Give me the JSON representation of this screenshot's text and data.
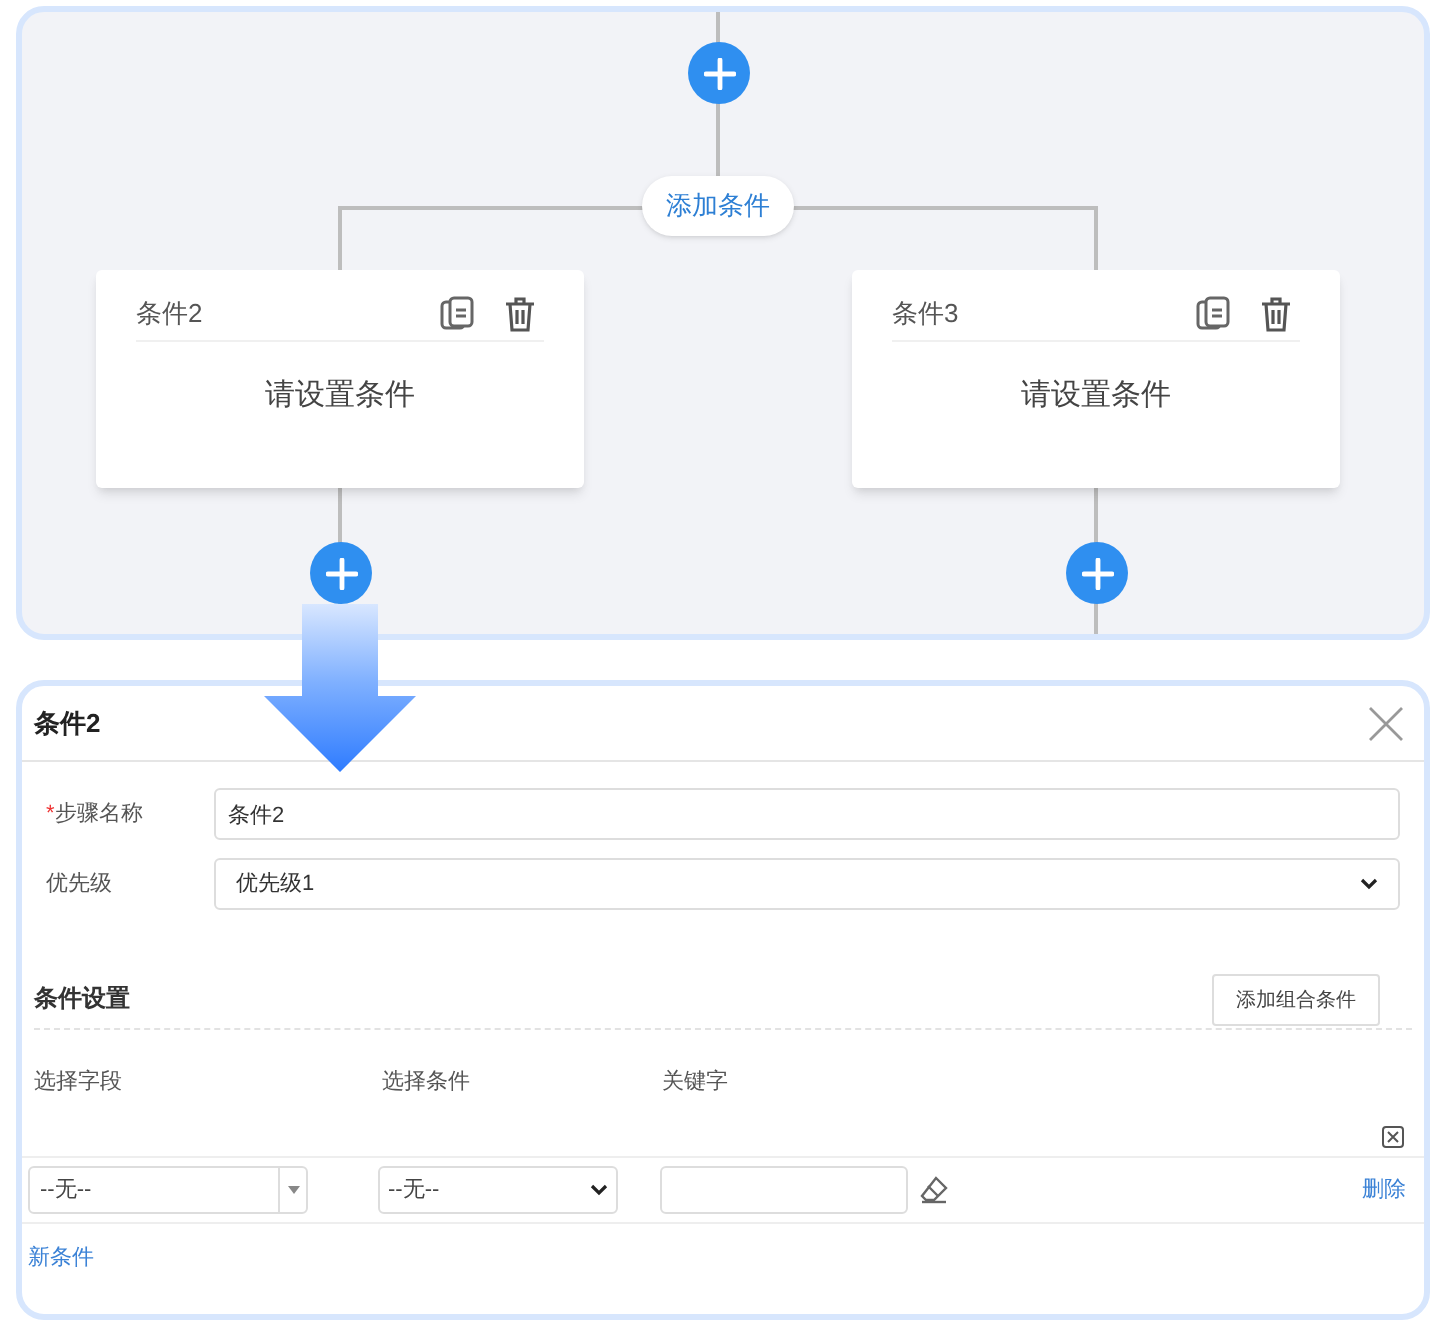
{
  "flow": {
    "add_condition_label": "添加条件",
    "branches": [
      {
        "title": "条件2",
        "body": "请设置条件"
      },
      {
        "title": "条件3",
        "body": "请设置条件"
      }
    ]
  },
  "dialog": {
    "title": "条件2",
    "fields": [
      {
        "kind": "input",
        "required_mark": "*",
        "label": "步骤名称",
        "value": "条件2"
      },
      {
        "kind": "select",
        "label": "优先级",
        "value": "优先级1"
      }
    ],
    "section_title": "条件设置",
    "add_group_button": "添加组合条件",
    "columns": [
      "选择字段",
      "选择条件",
      "关键字"
    ],
    "rows": [
      {
        "field": "--无--",
        "condition": "--无--",
        "delete": "删除"
      }
    ],
    "new_condition_link": "新条件"
  }
}
